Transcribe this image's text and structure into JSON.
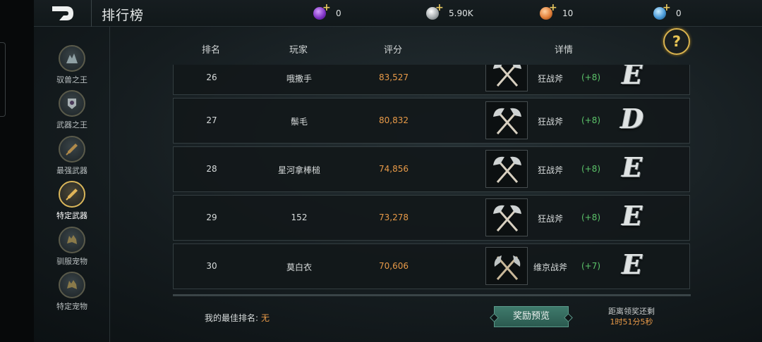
{
  "header": {
    "title": "排行榜",
    "currencies": [
      {
        "icon": "purple-gem-icon",
        "value": "0",
        "color": "#9a4fd8"
      },
      {
        "icon": "silver-coin-icon",
        "value": "5.90K",
        "color": "#c8cccc"
      },
      {
        "icon": "orange-gem-icon",
        "value": "10",
        "color": "#e2803a"
      },
      {
        "icon": "blue-gem-icon",
        "value": "0",
        "color": "#4a9ad8"
      }
    ]
  },
  "sidebar": {
    "items": [
      {
        "label": "驭兽之王",
        "icon": "beast-king-icon",
        "active": false
      },
      {
        "label": "武器之王",
        "icon": "weapon-king-icon",
        "active": false
      },
      {
        "label": "最强武器",
        "icon": "strongest-weapon-icon",
        "active": false
      },
      {
        "label": "特定武器",
        "icon": "specific-weapon-icon",
        "active": true
      },
      {
        "label": "驯服宠物",
        "icon": "tamed-pet-icon",
        "active": false
      },
      {
        "label": "特定宠物",
        "icon": "specific-pet-icon",
        "active": false
      }
    ]
  },
  "table": {
    "columns": {
      "rank": "排名",
      "player": "玩家",
      "score": "评分",
      "detail": "详情"
    },
    "rows": [
      {
        "rank": "26",
        "player": "哦撒手",
        "score": "83,527",
        "weapon": "狂战斧",
        "bonus": "(+8)",
        "grade": "E"
      },
      {
        "rank": "27",
        "player": "鬃毛",
        "score": "80,832",
        "weapon": "狂战斧",
        "bonus": "(+8)",
        "grade": "D"
      },
      {
        "rank": "28",
        "player": "星河拿棒槌",
        "score": "74,856",
        "weapon": "狂战斧",
        "bonus": "(+8)",
        "grade": "E"
      },
      {
        "rank": "29",
        "player": "152",
        "score": "73,278",
        "weapon": "狂战斧",
        "bonus": "(+8)",
        "grade": "E"
      },
      {
        "rank": "30",
        "player": "莫白衣",
        "score": "70,606",
        "weapon": "维京战斧",
        "bonus": "(+7)",
        "grade": "E"
      }
    ]
  },
  "footer": {
    "best_rank_label": "我的最佳排名:",
    "best_rank_value": "无",
    "reward_button": "奖励预览",
    "countdown_label": "距离领奖还剩",
    "countdown_time": "1时51分5秒"
  },
  "help": {
    "label": "?"
  }
}
